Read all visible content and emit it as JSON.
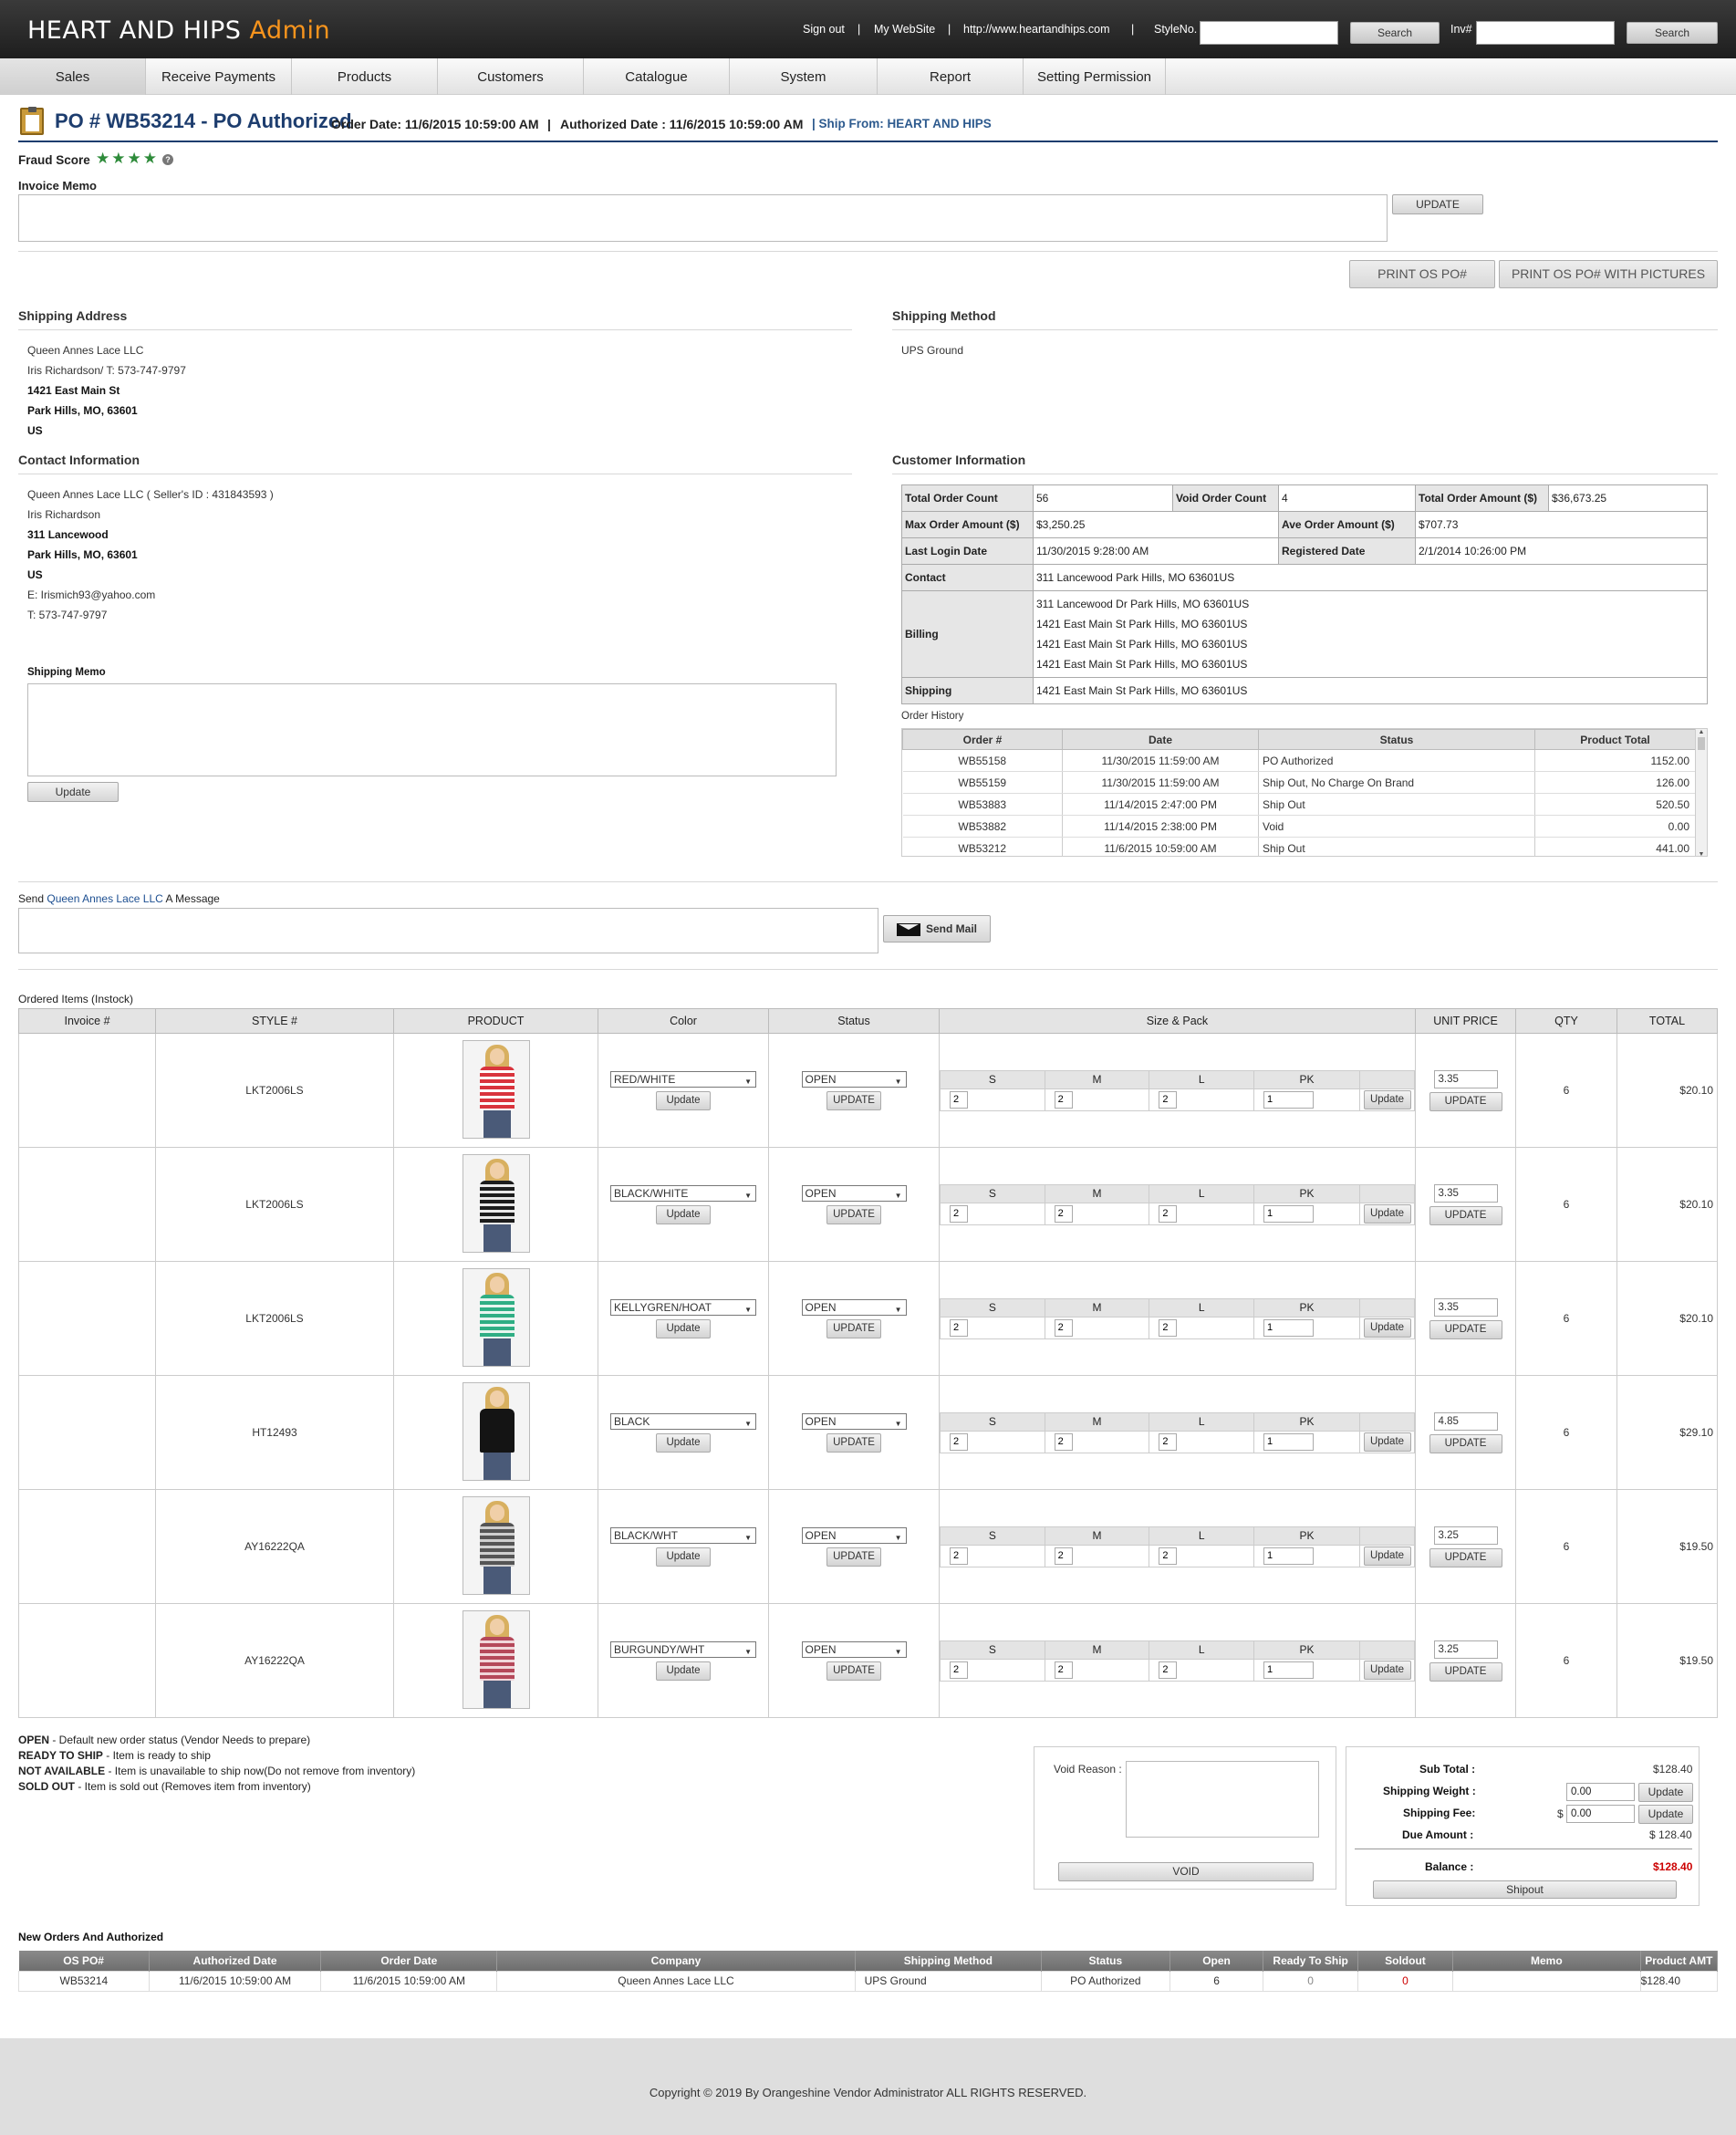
{
  "header": {
    "brand": "HEART AND HIPS",
    "brand_suffix": "Admin",
    "sign_out": "Sign out",
    "my_website": "My WebSite",
    "site_url": "http://www.heartandhips.com",
    "style_no_label": "StyleNo.",
    "search_label": "Search",
    "inv_label": "Inv#",
    "sep": "|"
  },
  "nav": [
    "Sales",
    "Receive Payments",
    "Products",
    "Customers",
    "Catalogue",
    "System",
    "Report",
    "Setting Permission"
  ],
  "po": {
    "title": "PO # WB53214 - PO Authorized",
    "order_date": "Order Date: 11/6/2015 10:59:00 AM",
    "sep": "|",
    "authorized_date": "Authorized Date : 11/6/2015 10:59:00 AM",
    "ship_from": "| Ship From: HEART AND HIPS"
  },
  "fraud": {
    "label": "Fraud Score",
    "stars": "★★★★",
    "help": "?"
  },
  "invoice_memo": {
    "label": "Invoice Memo",
    "update": "UPDATE"
  },
  "print": {
    "po": "PRINT OS PO#",
    "po_pictures": "PRINT OS PO# WITH PICTURES"
  },
  "shipping_address": {
    "title": "Shipping Address",
    "lines": [
      "Queen Annes Lace LLC",
      "Iris Richardson/ T: 573-747-9797",
      "1421 East Main St",
      "Park Hills, MO, 63601",
      "US"
    ]
  },
  "shipping_method": {
    "title": "Shipping Method",
    "value": "UPS Ground"
  },
  "contact": {
    "title": "Contact Information",
    "lines": [
      "Queen Annes Lace LLC ( Seller's ID : 431843593 )",
      "Iris Richardson",
      "311 Lancewood",
      "Park Hills, MO, 63601",
      "US",
      "E: Irismich93@yahoo.com",
      "T: 573-747-9797"
    ]
  },
  "shipping_memo": {
    "label": "Shipping Memo",
    "update": "Update"
  },
  "customer_info": {
    "title": "Customer Information",
    "total_order_count_label": "Total Order Count",
    "total_order_count": "56",
    "void_order_count_label": "Void Order Count",
    "void_order_count": "4",
    "total_order_amount_label": "Total Order Amount ($)",
    "total_order_amount": "$36,673.25",
    "max_order_amount_label": "Max Order Amount ($)",
    "max_order_amount": "$3,250.25",
    "ave_order_amount_label": "Ave Order Amount ($)",
    "ave_order_amount": "$707.73",
    "last_login_label": "Last Login Date",
    "last_login": "11/30/2015 9:28:00 AM",
    "registered_label": "Registered Date",
    "registered": "2/1/2014 10:26:00 PM",
    "contact_label": "Contact",
    "contact": "311 Lancewood Park Hills, MO 63601US",
    "billing_label": "Billing",
    "billing": [
      "311 Lancewood Dr Park Hills, MO 63601US",
      "1421 East Main St Park Hills, MO 63601US",
      "1421 East Main St Park Hills, MO 63601US",
      "1421 East Main St Park Hills, MO 63601US"
    ],
    "shipping_label": "Shipping",
    "shipping": "1421 East Main St Park Hills, MO 63601US"
  },
  "order_history": {
    "title": "Order History",
    "headers": [
      "Order #",
      "Date",
      "Status",
      "Product Total"
    ],
    "rows": [
      [
        "WB55158",
        "11/30/2015 11:59:00 AM",
        "PO Authorized",
        "1152.00"
      ],
      [
        "WB55159",
        "11/30/2015 11:59:00 AM",
        "Ship Out, No Charge On Brand",
        "126.00"
      ],
      [
        "WB53883",
        "11/14/2015 2:47:00 PM",
        "Ship Out",
        "520.50"
      ],
      [
        "WB53882",
        "11/14/2015 2:38:00 PM",
        "Void",
        "0.00"
      ],
      [
        "WB53212",
        "11/6/2015 10:59:00 AM",
        "Ship Out",
        "441.00"
      ]
    ]
  },
  "message": {
    "prefix": "Send",
    "company": "Queen Annes Lace LLC",
    "suffix": "A Message",
    "send": "Send Mail"
  },
  "items": {
    "title": "Ordered Items (Instock)",
    "headers": [
      "Invoice #",
      "STYLE #",
      "PRODUCT",
      "Color",
      "Status",
      "Size & Pack",
      "UNIT PRICE",
      "QTY",
      "TOTAL"
    ],
    "size_headers": [
      "S",
      "M",
      "L",
      "PK"
    ],
    "update": "Update",
    "update_caps": "UPDATE",
    "rows": [
      {
        "style": "LKT2006LS",
        "color": "RED/WHITE",
        "status": "OPEN",
        "s": "2",
        "m": "2",
        "l": "2",
        "pk": "1",
        "price": "3.35",
        "qty": "6",
        "total": "$20.10",
        "shirt": "#d9343d",
        "stripe": "#ffffff"
      },
      {
        "style": "LKT2006LS",
        "color": "BLACK/WHITE",
        "status": "OPEN",
        "s": "2",
        "m": "2",
        "l": "2",
        "pk": "1",
        "price": "3.35",
        "qty": "6",
        "total": "$20.10",
        "shirt": "#1c1c1c",
        "stripe": "#e8e8e8"
      },
      {
        "style": "LKT2006LS",
        "color": "KELLYGREN/HOAT",
        "status": "OPEN",
        "s": "2",
        "m": "2",
        "l": "2",
        "pk": "1",
        "price": "3.35",
        "qty": "6",
        "total": "$20.10",
        "shirt": "#2fae84",
        "stripe": "#e8f5ef"
      },
      {
        "style": "HT12493",
        "color": "BLACK",
        "status": "OPEN",
        "s": "2",
        "m": "2",
        "l": "2",
        "pk": "1",
        "price": "4.85",
        "qty": "6",
        "total": "$29.10",
        "shirt": "#141414",
        "stripe": "#141414"
      },
      {
        "style": "AY16222QA",
        "color": "BLACK/WHT",
        "status": "OPEN",
        "s": "2",
        "m": "2",
        "l": "2",
        "pk": "1",
        "price": "3.25",
        "qty": "6",
        "total": "$19.50",
        "shirt": "#555555",
        "stripe": "#cfcfcf"
      },
      {
        "style": "AY16222QA",
        "color": "BURGUNDY/WHT",
        "status": "OPEN",
        "s": "2",
        "m": "2",
        "l": "2",
        "pk": "1",
        "price": "3.25",
        "qty": "6",
        "total": "$19.50",
        "shirt": "#b5485a",
        "stripe": "#f1d6da"
      }
    ]
  },
  "legend": [
    {
      "k": "OPEN",
      "v": " - Default new order status (Vendor Needs to prepare)"
    },
    {
      "k": "READY TO SHIP",
      "v": " - Item is ready to ship"
    },
    {
      "k": "NOT AVAILABLE",
      "v": " - Item is unavailable to ship now(Do not remove from inventory)"
    },
    {
      "k": "SOLD OUT",
      "v": " - Item is sold out (Removes item from inventory)"
    }
  ],
  "void": {
    "label": "Void Reason :",
    "button": "VOID"
  },
  "totals": {
    "sub_total_label": "Sub Total :",
    "sub_total": "$128.40",
    "shipping_weight_label": "Shipping Weight :",
    "shipping_weight": "0.00",
    "shipping_fee_label": "Shipping Fee:",
    "currency": "$",
    "shipping_fee": "0.00",
    "update": "Update",
    "due_label": "Due Amount :",
    "due": "$ 128.40",
    "balance_label": "Balance :",
    "balance": "$128.40",
    "shipout": "Shipout"
  },
  "new_orders": {
    "title": "New Orders And Authorized",
    "headers": [
      "OS PO#",
      "Authorized Date",
      "Order Date",
      "Company",
      "Shipping Method",
      "Status",
      "Open",
      "Ready To Ship",
      "Soldout",
      "Memo",
      "Product AMT"
    ],
    "row": [
      "WB53214",
      "11/6/2015 10:59:00 AM",
      "11/6/2015 10:59:00 AM",
      "Queen Annes Lace LLC",
      "UPS Ground",
      "PO Authorized",
      "6",
      "0",
      "0",
      "",
      "$128.40"
    ]
  },
  "footer": "Copyright © 2019 By Orangeshine Vendor Administrator ALL RIGHTS RESERVED.",
  "colors": {
    "brand_orange": "#f7941d",
    "title_blue": "#1d3d6e",
    "balance_red": "#cc0000",
    "star_green": "#2e8b3a"
  }
}
